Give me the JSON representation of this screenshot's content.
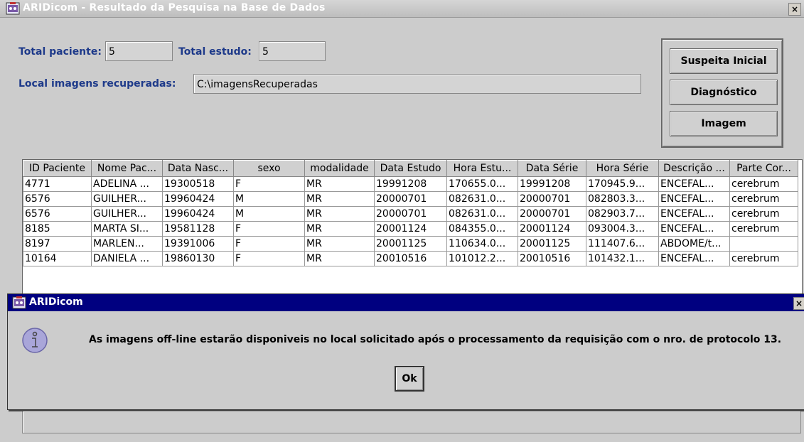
{
  "window": {
    "title": "ARIDicom - Resultado da Pesquisa na Base de Dados",
    "close_label": "×"
  },
  "form": {
    "total_paciente_label": "Total paciente:",
    "total_paciente_value": "5",
    "total_estudo_label": "Total estudo:",
    "total_estudo_value": "5",
    "local_label": "Local imagens recuperadas:",
    "local_value": "C:\\imagensRecuperadas"
  },
  "buttons": {
    "suspeita_label": "Suspeita Inicial",
    "diagnostico_label": "Diagnóstico",
    "imagem_label": "Imagem"
  },
  "table": {
    "headers": [
      "ID Paciente",
      "Nome Pac...",
      "Data Nasc...",
      "sexo",
      "modalidade",
      "Data Estudo",
      "Hora Estu...",
      "Data Série",
      "Hora Série",
      "Descrição ...",
      "Parte Cor..."
    ],
    "rows": [
      [
        "4771",
        "ADELINA ...",
        "19300518",
        "F",
        "MR",
        "19991208",
        "170655.0...",
        "19991208",
        "170945.9...",
        "ENCEFAL...",
        "cerebrum"
      ],
      [
        "6576",
        "GUILHER...",
        "19960424",
        "M",
        "MR",
        "20000701",
        "082631.0...",
        "20000701",
        "082803.3...",
        "ENCEFAL...",
        "cerebrum"
      ],
      [
        "6576",
        "GUILHER...",
        "19960424",
        "M",
        "MR",
        "20000701",
        "082631.0...",
        "20000701",
        "082903.7...",
        "ENCEFAL...",
        "cerebrum"
      ],
      [
        "8185",
        "MARTA SI...",
        "19581128",
        "F",
        "MR",
        "20001124",
        "084355.0...",
        "20001124",
        "093004.3...",
        "ENCEFAL...",
        "cerebrum"
      ],
      [
        "8197",
        "MARLEN...",
        "19391006",
        "F",
        "MR",
        "20001125",
        "110634.0...",
        "20001125",
        "111407.6...",
        "ABDOME/t...",
        ""
      ],
      [
        "10164",
        "DANIELA ...",
        "19860130",
        "F",
        "MR",
        "20010516",
        "101012.2...",
        "20010516",
        "101432.1...",
        "ENCEFAL...",
        "cerebrum"
      ]
    ]
  },
  "dialog": {
    "title": "ARIDicom",
    "close_label": "×",
    "message": "As imagens off-line estarão disponiveis no local solicitado após o processamento da requisição com o nro. de protocolo 13.",
    "ok_label": "Ok"
  },
  "colors": {
    "label_blue": "#1e3a8a",
    "dialog_title_bg": "#000080"
  },
  "icons": {
    "app": "aridicom-app-icon",
    "info": "info-icon"
  }
}
